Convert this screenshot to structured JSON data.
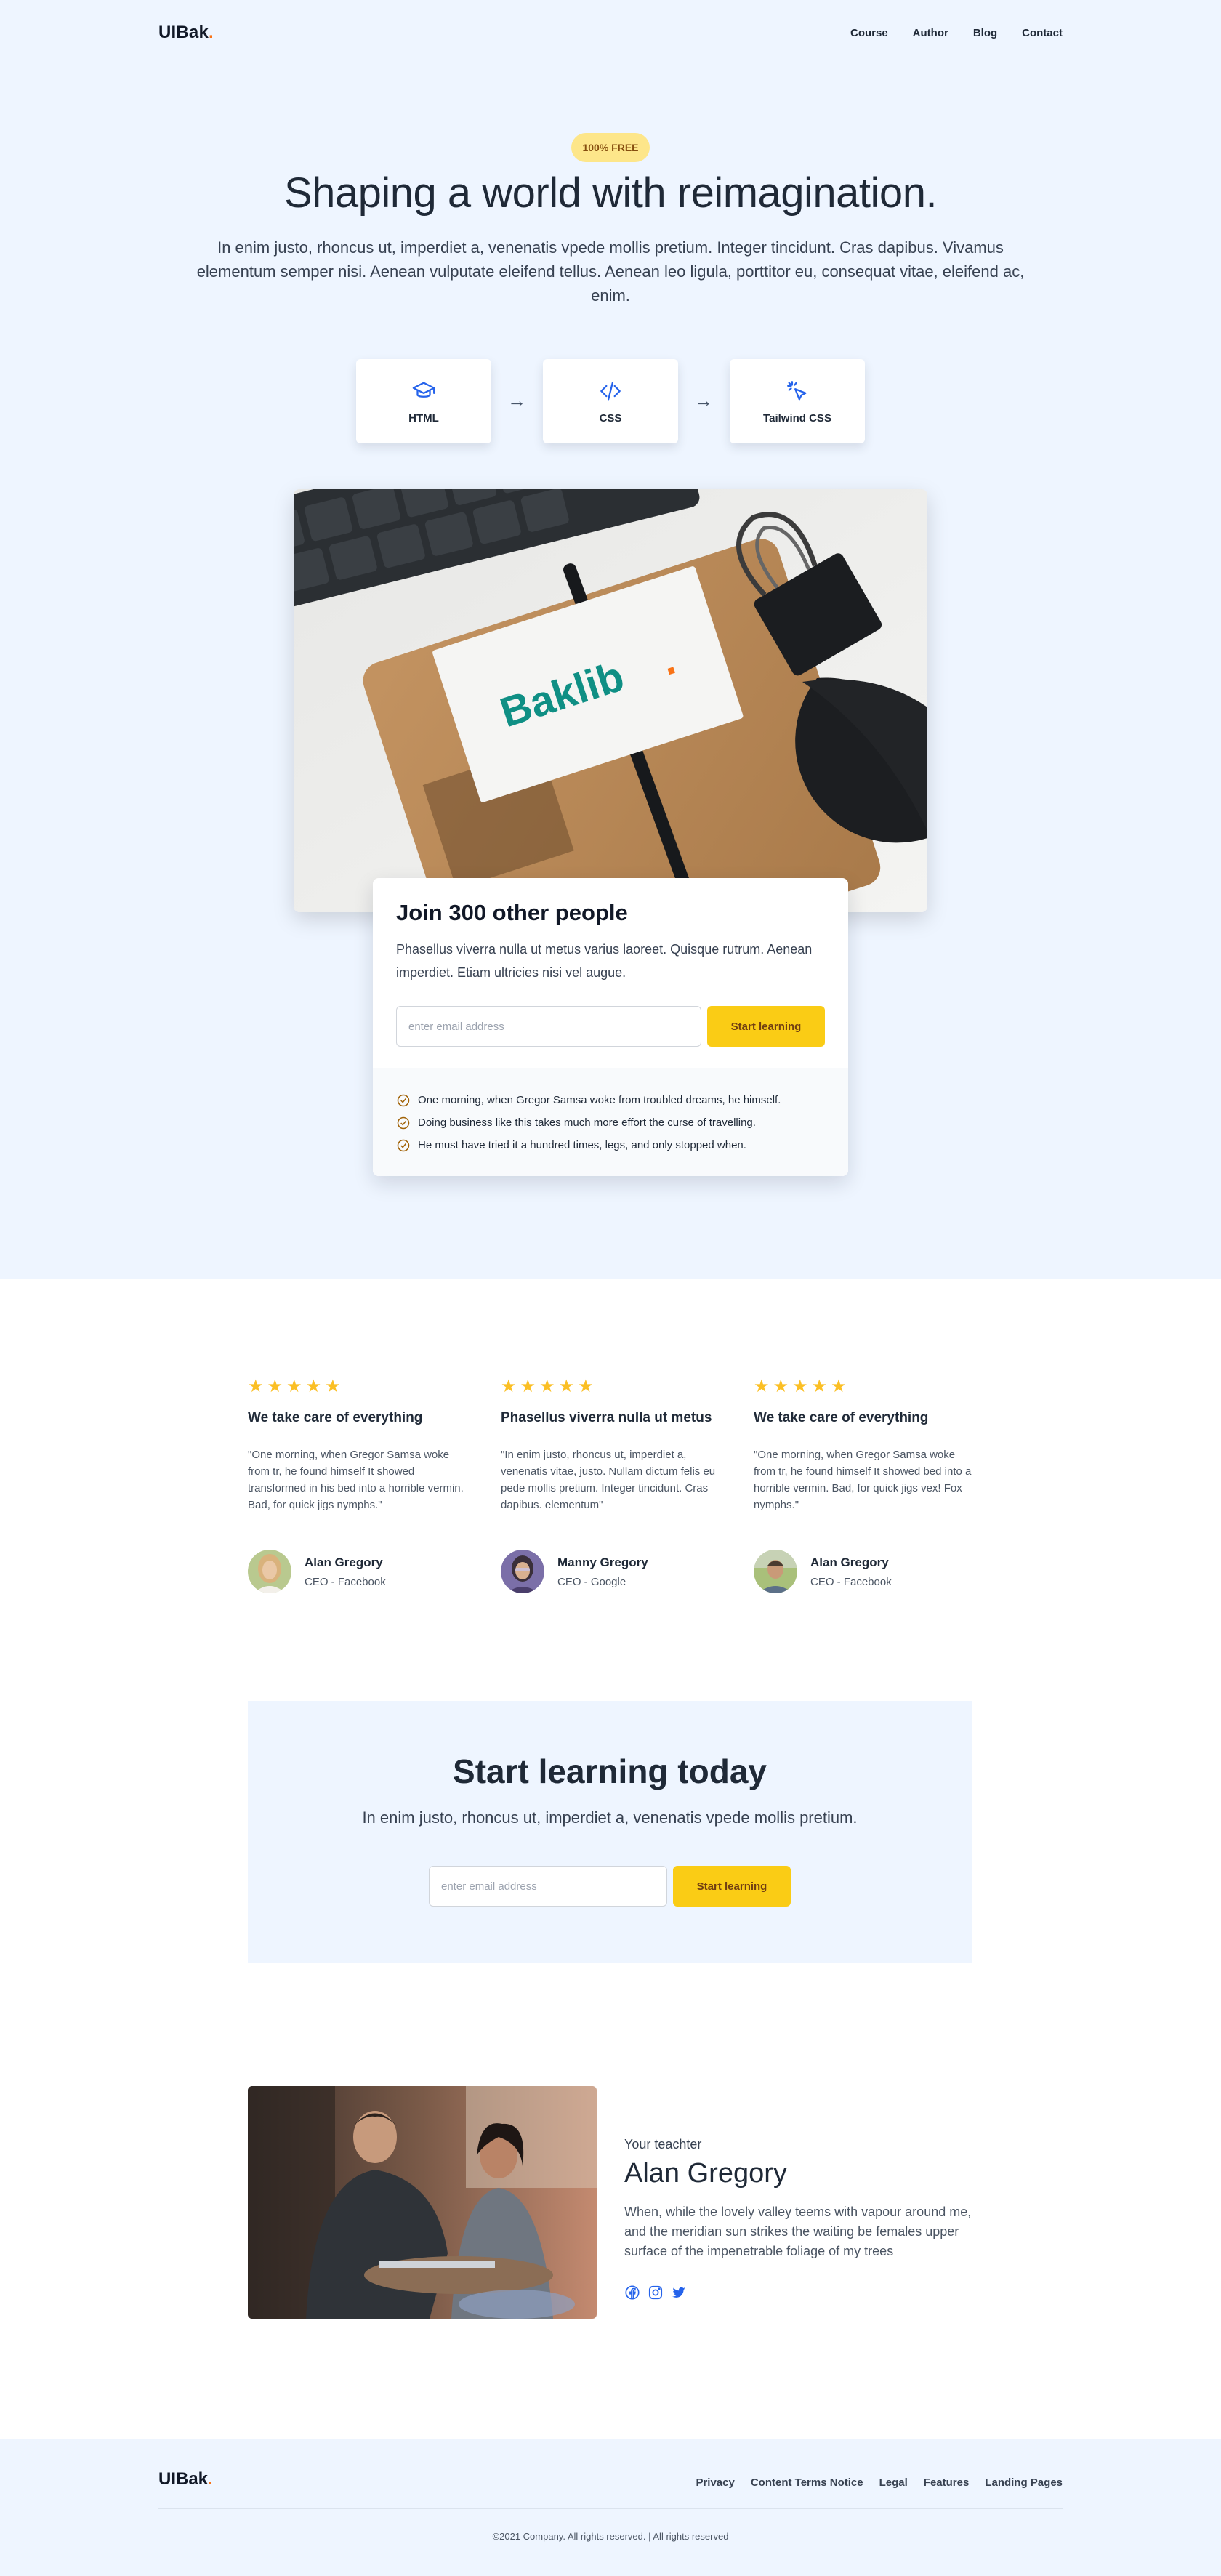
{
  "brand": {
    "name": "UIBak",
    "dot": "."
  },
  "nav": {
    "links": [
      "Course",
      "Author",
      "Blog",
      "Contact"
    ]
  },
  "hero": {
    "badge": "100% FREE",
    "title": "Shaping a world with reimagination.",
    "subtitle": "In enim justo, rhoncus ut, imperdiet a, venenatis vpede mollis pretium. Integer tincidunt. Cras dapibus. Vivamus elementum semper nisi. Aenean vulputate eleifend tellus. Aenean leo ligula, porttitor eu, consequat vitae, eleifend ac, enim.",
    "tech": [
      {
        "label": "HTML",
        "icon": "graduation-cap-icon"
      },
      {
        "label": "CSS",
        "icon": "code-icon"
      },
      {
        "label": "Tailwind CSS",
        "icon": "cursor-click-icon"
      }
    ],
    "arrow": "→",
    "image_brand_text": "Baklib",
    "image_brand_dot": "."
  },
  "join": {
    "title": "Join 300 other people",
    "text": "Phasellus viverra nulla ut metus varius laoreet. Quisque rutrum. Aenean imperdiet. Etiam ultricies nisi vel augue.",
    "input_placeholder": "enter email address",
    "button": "Start learning",
    "checks": [
      "One morning, when Gregor Samsa woke from troubled dreams, he himself.",
      "Doing business like this takes much more effort the curse of travelling.",
      "He must have tried it a hundred times, legs, and only stopped when."
    ]
  },
  "testimonials": [
    {
      "stars": "★",
      "title": "We take care of everything",
      "quote": "\"One morning, when Gregor Samsa woke from tr, he found himself It showed transformed in his bed into a horrible vermin. Bad, for quick jigs nymphs.\"",
      "name": "Alan Gregory",
      "role": "CEO - Facebook"
    },
    {
      "stars": "★",
      "title": "Phasellus viverra nulla ut metus",
      "quote": "\"In enim justo, rhoncus ut, imperdiet a, venenatis vitae, justo. Nullam dictum felis eu pede mollis pretium. Integer tincidunt. Cras dapibus. elementum\"",
      "name": "Manny Gregory",
      "role": "CEO - Google"
    },
    {
      "stars": "★",
      "title": "We take care of everything",
      "quote": "\"One morning, when Gregor Samsa woke from tr, he found himself It showed bed into a horrible vermin. Bad, for quick jigs vex! Fox nymphs.\"",
      "name": "Alan Gregory",
      "role": "CEO - Facebook"
    }
  ],
  "rating": 5,
  "cta": {
    "title": "Start learning today",
    "subtitle": "In enim justo, rhoncus ut, imperdiet a, venenatis vpede mollis pretium.",
    "input_placeholder": "enter email address",
    "button": "Start learning"
  },
  "teacher": {
    "kicker": "Your teachter",
    "name": "Alan Gregory",
    "bio": "When, while the lovely valley teems with vapour around me, and the meridian sun strikes the waiting be females upper surface of the impenetrable foliage of my trees",
    "socials": [
      "facebook-icon",
      "instagram-icon",
      "twitter-icon"
    ]
  },
  "footer": {
    "links": [
      "Privacy",
      "Content Terms Notice",
      "Legal",
      "Features",
      "Landing Pages"
    ],
    "copyright": "©2021 Company. All rights reserved. | All rights reserved"
  },
  "colors": {
    "accent": "#facc15",
    "brand_dot": "#f97316",
    "hero_bg": "#eef5ff",
    "icon_blue": "#2563eb",
    "check": "#a16207"
  }
}
